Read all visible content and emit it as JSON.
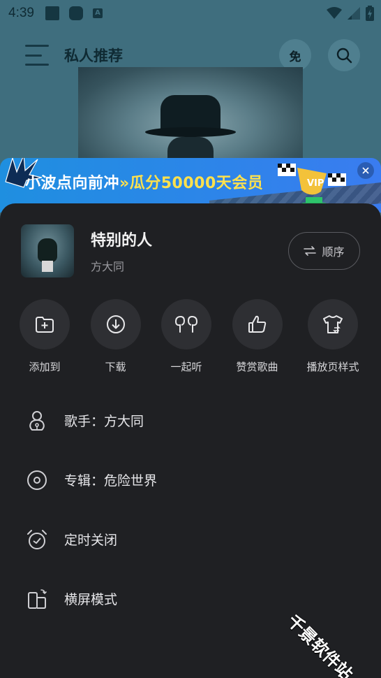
{
  "status_bar": {
    "time": "4:39",
    "a_icon_glyph": "A"
  },
  "header": {
    "title": "私人推荐",
    "free_label": "免"
  },
  "banner": {
    "text_main": "小波点向前冲",
    "text_arrow": "»",
    "text_highlight": "瓜分50000天会员",
    "trophy_tag": "VIP"
  },
  "song": {
    "title": "特别的人",
    "artist": "方大同",
    "order_label": "顺序"
  },
  "actions": [
    {
      "label": "添加到",
      "icon": "add-folder-icon"
    },
    {
      "label": "下载",
      "icon": "download-icon"
    },
    {
      "label": "一起听",
      "icon": "earbuds-icon"
    },
    {
      "label": "赞赏歌曲",
      "icon": "thumbs-up-icon"
    },
    {
      "label": "播放页样式",
      "icon": "tshirt-icon"
    }
  ],
  "menu": [
    {
      "label": "歌手：方大同",
      "icon": "singer-icon"
    },
    {
      "label": "专辑：危险世界",
      "icon": "album-disc-icon"
    },
    {
      "label": "定时关闭",
      "icon": "alarm-clock-icon"
    },
    {
      "label": "横屏模式",
      "icon": "landscape-icon"
    }
  ],
  "watermark": "千景软件站",
  "colors": {
    "sheet_bg": "#1f2023",
    "banner_blue": "#2b86e8",
    "highlight_yellow": "#ffe14d",
    "page_bg": "#3f6e7e"
  }
}
